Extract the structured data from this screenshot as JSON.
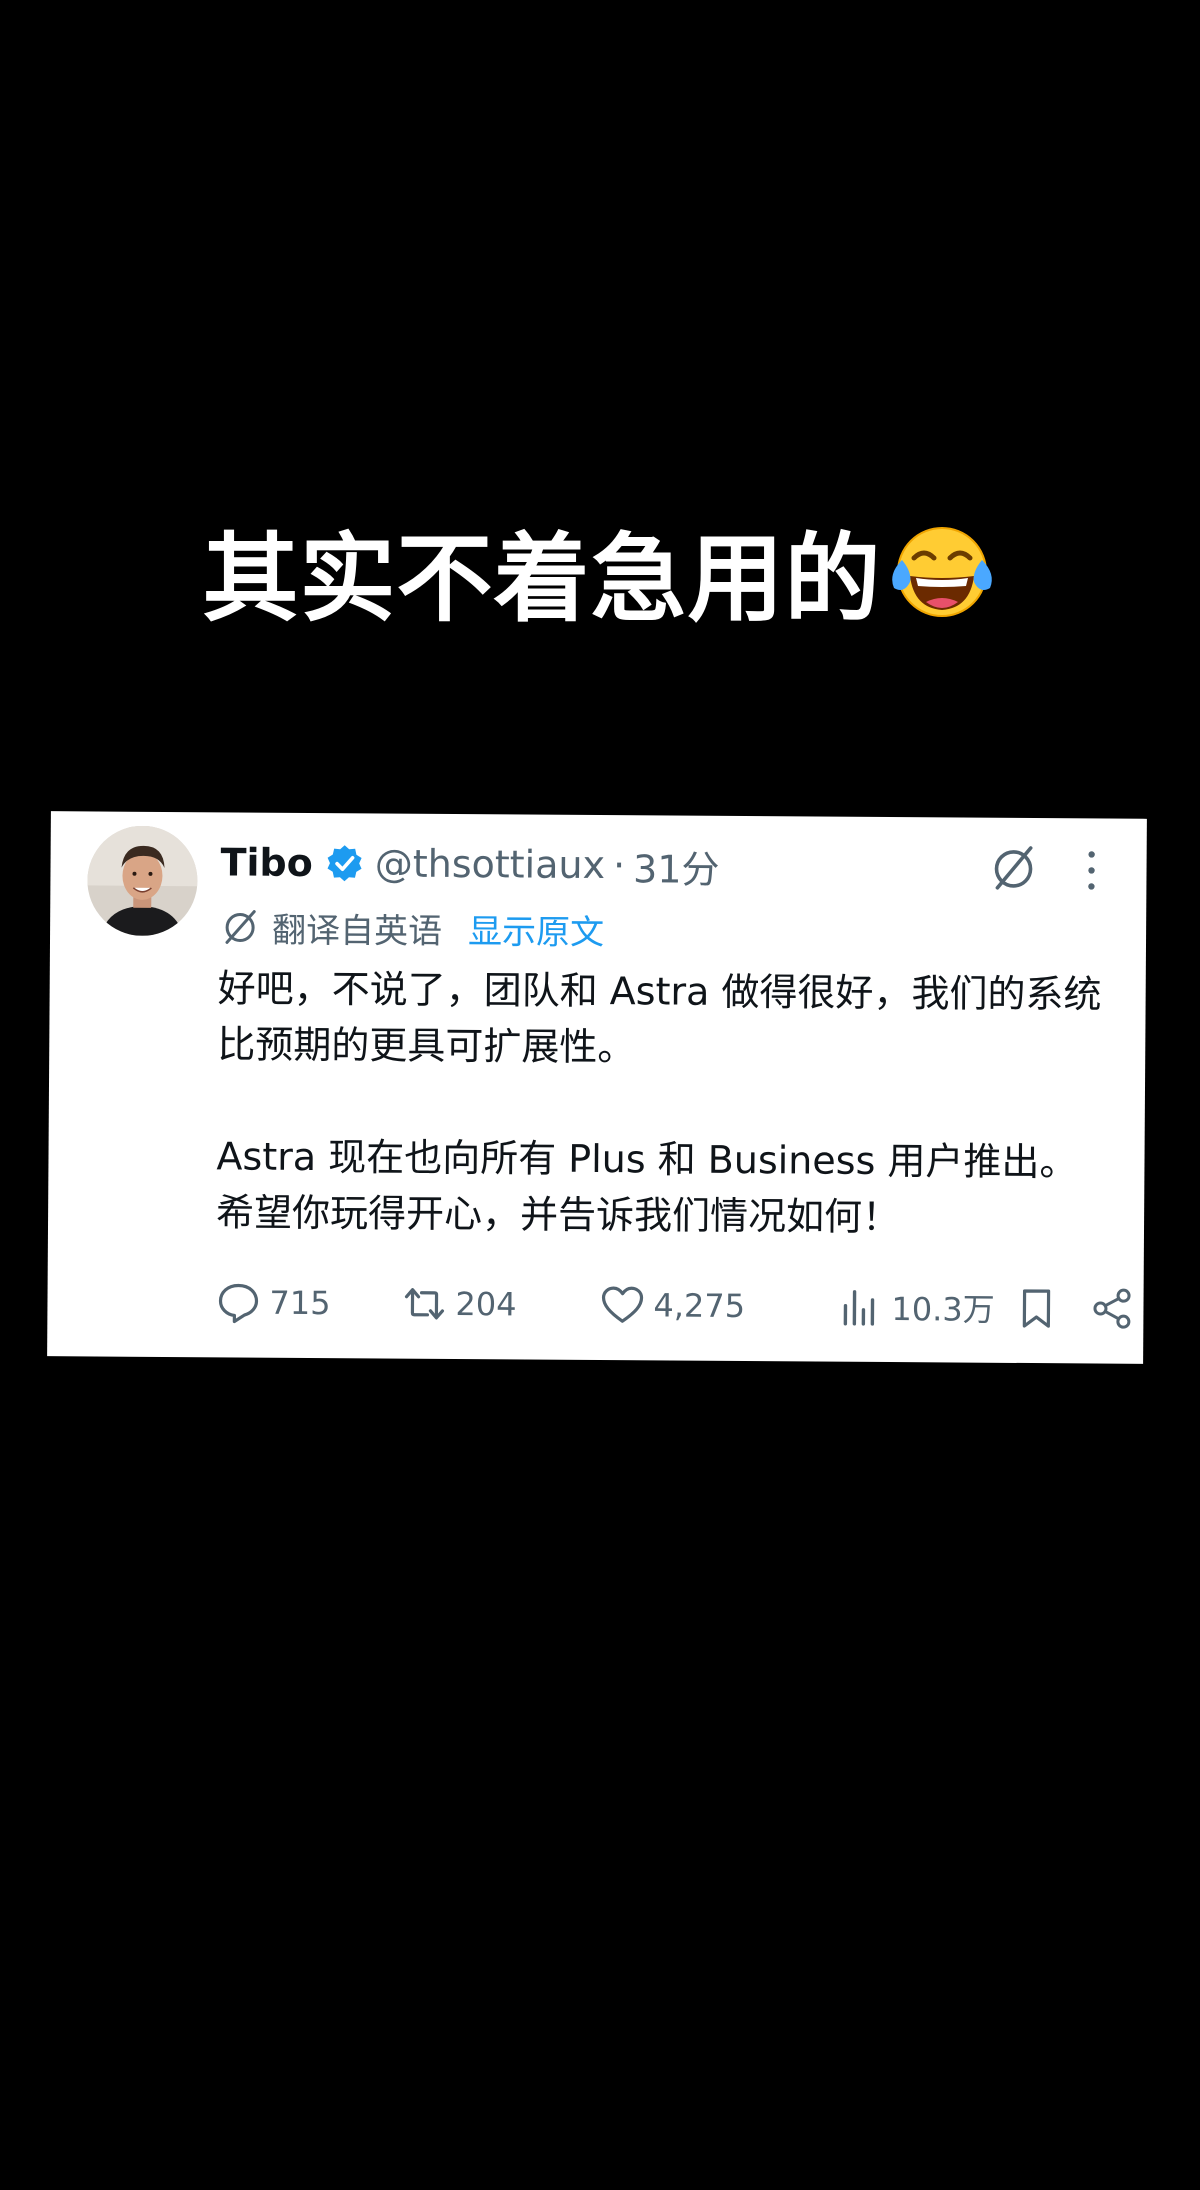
{
  "caption": {
    "text": "其实不着急用的",
    "emoji": "face-with-tears-of-joy"
  },
  "tweet": {
    "author_name": "Tibo",
    "verified": true,
    "handle": "@thsottiaux",
    "separator": "·",
    "time": "31分",
    "translated_label": "翻译自英语",
    "show_original_label": "显示原文",
    "paragraphs": [
      "好吧，不说了，团队和 Astra 做得很好，我们的系统比预期的更具可扩展性。",
      "Astra 现在也向所有 Plus 和 Business 用户推出。希望你玩得开心，并告诉我们情况如何！"
    ],
    "stats": {
      "replies": "715",
      "retweets": "204",
      "likes": "4,275",
      "views": "10.3万"
    }
  },
  "icons": {
    "verified": "verified-badge-icon",
    "grok": "grok-icon",
    "more": "more-vertical-icon",
    "translate": "translate-icon",
    "reply": "reply-icon",
    "retweet": "retweet-icon",
    "like": "heart-icon",
    "views": "views-icon",
    "bookmark": "bookmark-icon",
    "share": "share-icon"
  },
  "colors": {
    "background": "#000000",
    "card": "#ffffff",
    "text_primary": "#0f1419",
    "text_secondary": "#536471",
    "accent_blue": "#1d9bf0"
  }
}
